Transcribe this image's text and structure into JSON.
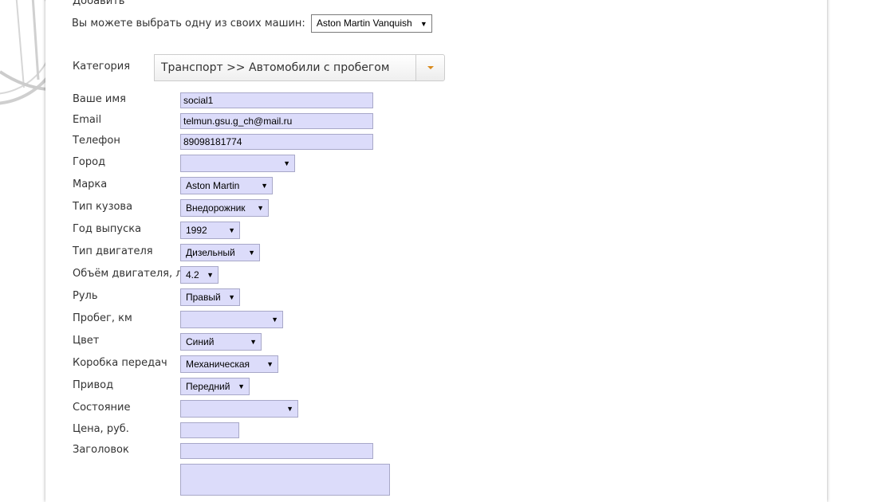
{
  "header": {
    "add_title": "Добавить",
    "choose_label": "Вы можете выбрать одну из своих машин:",
    "choose_value": "Aston Martin Vanquish"
  },
  "category": {
    "label": "Категория",
    "value": "Транспорт >> Автомобили с пробегом"
  },
  "fields": {
    "name": {
      "label": "Ваше имя",
      "value": "social1"
    },
    "email": {
      "label": "Email",
      "value": "telmun.gsu.g_ch@mail.ru"
    },
    "phone": {
      "label": "Телефон",
      "value": "89098181774"
    },
    "city": {
      "label": "Город",
      "value": ""
    },
    "brand": {
      "label": "Марка",
      "value": "Aston Martin"
    },
    "body": {
      "label": "Тип кузова",
      "value": "Внедорожник"
    },
    "year": {
      "label": "Год выпуска",
      "value": "1992"
    },
    "engine_type": {
      "label": "Тип двигателя",
      "value": "Дизельный"
    },
    "engine_volume": {
      "label": "Объём двигателя, л",
      "value": "4.2"
    },
    "steering": {
      "label": "Руль",
      "value": "Правый"
    },
    "mileage": {
      "label": "Пробег, км",
      "value": ""
    },
    "color": {
      "label": "Цвет",
      "value": "Синий"
    },
    "gearbox": {
      "label": "Коробка передач",
      "value": "Механическая"
    },
    "drive": {
      "label": "Привод",
      "value": "Передний"
    },
    "condition": {
      "label": "Состояние",
      "value": ""
    },
    "price": {
      "label": "Цена, руб.",
      "value": ""
    },
    "headline": {
      "label": "Заголовок",
      "value": ""
    }
  },
  "colors": {
    "field_bg": "#dcdcfa",
    "field_border": "#a8a8c8",
    "dropdown_accent": "#d98a1c"
  }
}
